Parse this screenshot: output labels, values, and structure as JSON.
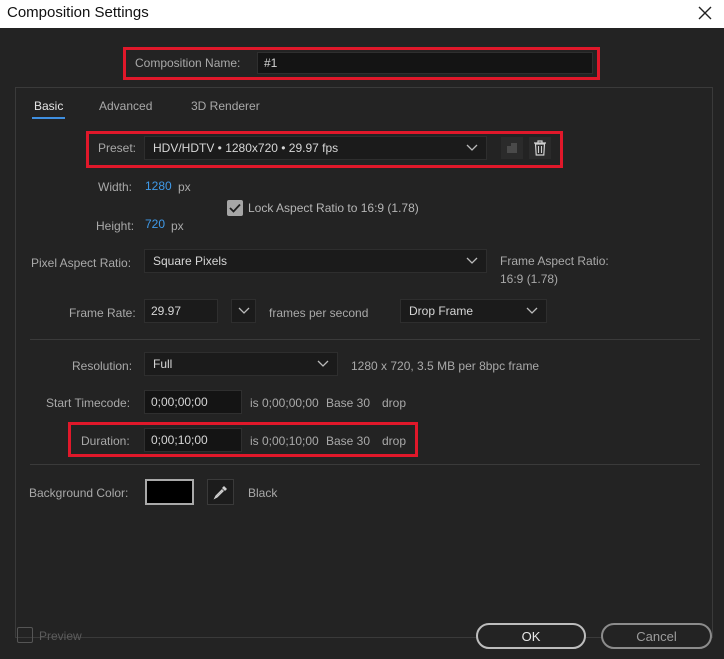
{
  "window": {
    "title": "Composition Settings"
  },
  "composition": {
    "name_label": "Composition Name:",
    "name_value": "#1"
  },
  "tabs": [
    {
      "label": "Basic",
      "active": true
    },
    {
      "label": "Advanced",
      "active": false
    },
    {
      "label": "3D Renderer",
      "active": false
    }
  ],
  "preset": {
    "label": "Preset:",
    "value": "HDV/HDTV  •  1280x720 • 29.97 fps",
    "icons": [
      "save-preset-icon",
      "trash-icon"
    ]
  },
  "size": {
    "width_label": "Width:",
    "width_value": "1280",
    "height_label": "Height:",
    "height_value": "720",
    "unit": "px",
    "lock_label": "Lock Aspect Ratio to 16:9 (1.78)",
    "lock_checked": true
  },
  "pixel_aspect": {
    "label": "Pixel Aspect Ratio:",
    "value": "Square Pixels",
    "frame_aspect_label": "Frame Aspect Ratio:",
    "frame_aspect_value": "16:9 (1.78)"
  },
  "frame_rate": {
    "label": "Frame Rate:",
    "value": "29.97",
    "unit": "frames per second",
    "drop_value": "Drop Frame"
  },
  "resolution": {
    "label": "Resolution:",
    "value": "Full",
    "info": "1280 x 720, 3.5 MB per 8bpc frame"
  },
  "start_timecode": {
    "label": "Start Timecode:",
    "value": "0;00;00;00",
    "info_is": "is 0;00;00;00",
    "info_base": "Base 30",
    "info_drop": "drop"
  },
  "duration": {
    "label": "Duration:",
    "value": "0;00;10;00",
    "info_is": "is 0;00;10;00",
    "info_base": "Base 30",
    "info_drop": "drop"
  },
  "background": {
    "label": "Background Color:",
    "color": "#000000",
    "color_name": "Black"
  },
  "footer": {
    "preview_label": "Preview",
    "ok_label": "OK",
    "cancel_label": "Cancel"
  },
  "colors": {
    "highlight": "#e0182a",
    "accent_blue": "#3f9ae9"
  }
}
